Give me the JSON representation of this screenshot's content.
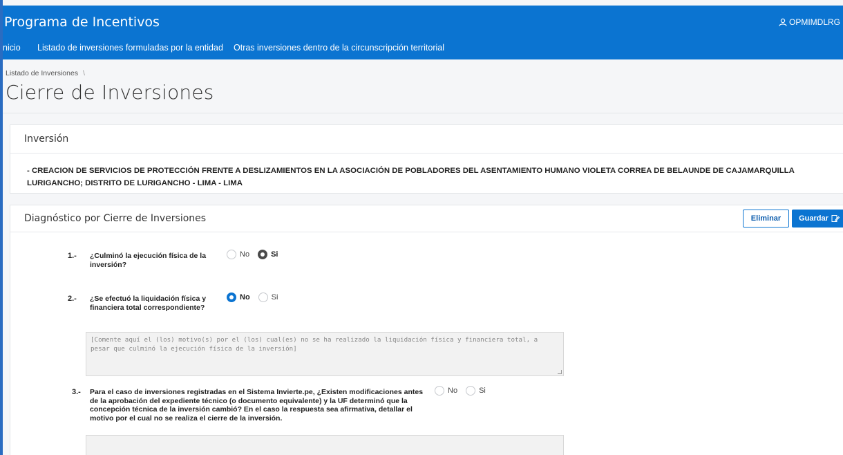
{
  "app": {
    "title": "Programa de Incentivos",
    "user": "OPMIMDLRG"
  },
  "nav": {
    "items": [
      "nicio",
      "Listado de inversiones formuladas por la entidad",
      "Otras inversiones dentro de la circunscripción territorial"
    ]
  },
  "breadcrumb": {
    "items": [
      "Listado de Inversiones",
      "\\"
    ]
  },
  "page": {
    "title": "Cierre de Inversiones"
  },
  "investment": {
    "header": "Inversión",
    "description": "- CREACION DE SERVICIOS DE PROTECCIÓN FRENTE A DESLIZAMIENTOS EN LA ASOCIACIÓN DE POBLADORES DEL ASENTAMIENTO HUMANO VIOLETA CORREA DE BELAUNDE DE CAJAMARQUILLA LURIGANCHO; DISTRITO DE LURIGANCHO - LIMA - LIMA"
  },
  "diagnostic": {
    "header": "Diagnóstico por Cierre de Inversiones",
    "delete_label": "Eliminar",
    "save_label": "Guardar",
    "questions": [
      {
        "number": "1.-",
        "text": "¿Culminó la ejecución física de la inversión?",
        "no_label": "No",
        "yes_label": "Si",
        "selected": "Si"
      },
      {
        "number": "2.-",
        "text": "¿Se efectuó la liquidación física y financiera total correspondiente?",
        "no_label": "No",
        "yes_label": "Si",
        "selected": "No",
        "comment_placeholder": "[Comente aquí el (los) motivo(s) por el (los) cual(es) no se ha realizado la liquidación física y financiera total, a pesar que culminó la ejecución física de la inversión]"
      },
      {
        "number": "3.-",
        "text": "Para el caso de inversiones registradas en el Sistema Invierte.pe, ¿Existen modificaciones antes de la aprobación del expediente técnico (o documento equivalente) y la UF determinó que la concepción técnica de la inversión cambió? En el caso la respuesta sea afirmativa, detallar el motivo por el cual no se realiza el cierre de la inversión.",
        "no_label": "No",
        "yes_label": "Si",
        "selected": ""
      }
    ]
  },
  "colors": {
    "primary": "#0b74d1",
    "background": "#f5f6f8"
  }
}
